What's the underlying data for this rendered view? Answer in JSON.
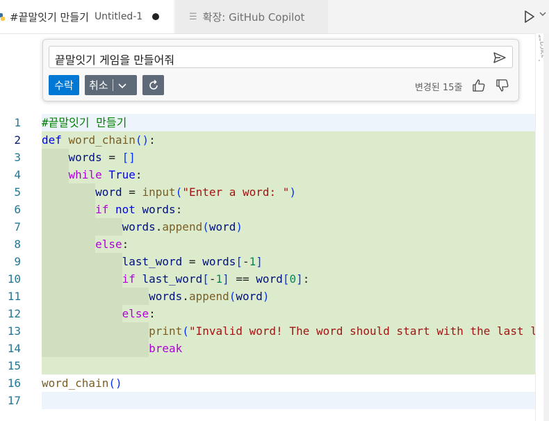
{
  "tabs": [
    {
      "title": "#끝말잇기 만들기",
      "subtitle": "Untitled-1",
      "dirty": true,
      "icon": "python-icon"
    },
    {
      "title": "확장: GitHub Copilot",
      "icon": "document-icon"
    }
  ],
  "toolbar": {
    "run_icon": "play-icon",
    "more_icon": "chevron-down-icon"
  },
  "chat": {
    "prompt": "끝말잇기 게임을 만들어줘",
    "accept_label": "수락",
    "cancel_label": "취소",
    "changed_label": "변경된 15줄",
    "icons": {
      "send": "send-icon",
      "regenerate": "refresh-icon",
      "thumbs_up": "thumbs-up-icon",
      "thumbs_down": "thumbs-down-icon"
    }
  },
  "editor": {
    "line_numbers": [
      "1",
      "2",
      "3",
      "4",
      "5",
      "6",
      "7",
      "8",
      "9",
      "10",
      "11",
      "12",
      "13",
      "14",
      "15",
      "16",
      "17"
    ],
    "lines": [
      "#끝말잇기 만들기",
      "def word_chain():",
      "    words = []",
      "    while True:",
      "        word = input(\"Enter a word: \")",
      "        if not words:",
      "            words.append(word)",
      "        else:",
      "            last_word = words[-1]",
      "            if last_word[-1] == word[0]:",
      "                words.append(word)",
      "            else:",
      "                print(\"Invalid word! The word should start with the last let",
      "                break",
      "",
      "word_chain()",
      ""
    ]
  },
  "colors": {
    "accent": "#0078d4",
    "secondary_button": "#5f6a79",
    "diff_added": "#dcebcb",
    "comment": "#008000",
    "keyword": "#0000ff",
    "control": "#af00db",
    "function": "#795e26",
    "string": "#a31515",
    "number": "#098658",
    "variable": "#001080"
  }
}
